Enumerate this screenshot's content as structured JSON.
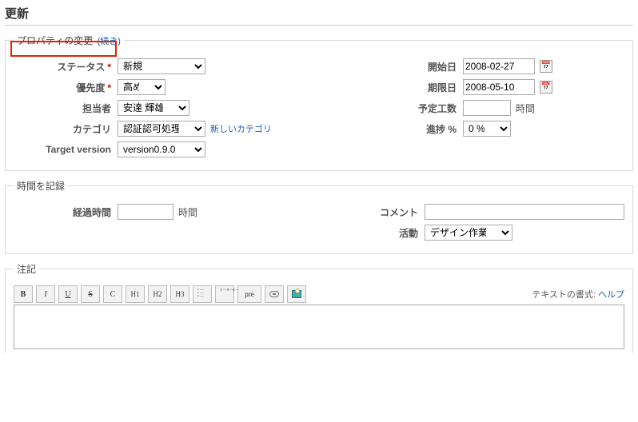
{
  "title": "更新",
  "properties": {
    "legend": "プロパティの変更",
    "more_link": "(続き)",
    "status_label": "ステータス",
    "status_value": "新規",
    "priority_label": "優先度",
    "priority_value": "高め",
    "assignee_label": "担当者",
    "assignee_value": "安達 輝雄",
    "category_label": "カテゴリ",
    "category_value": "認証認可処理",
    "new_category": "新しいカテゴリ",
    "target_version_label": "Target version",
    "target_version_value": "version0.9.0",
    "start_date_label": "開始日",
    "start_date_value": "2008-02-27",
    "due_date_label": "期限日",
    "due_date_value": "2008-05-10",
    "est_hours_label": "予定工数",
    "est_hours_unit": "時間",
    "progress_label": "進捗 %",
    "progress_value": "0 %"
  },
  "time": {
    "legend": "時間を記録",
    "elapsed_label": "経過時間",
    "elapsed_unit": "時間",
    "comment_label": "コメント",
    "activity_label": "活動",
    "activity_value": "デザイン作業"
  },
  "notes": {
    "legend": "注記",
    "format_label": "テキストの書式:",
    "help_link": "ヘルプ"
  },
  "toolbar": {
    "bold": "B",
    "italic": "I",
    "underline": "U",
    "strike": "S",
    "code": "C",
    "h1": "H1",
    "h2": "H2",
    "h3": "H3",
    "pre": "pre"
  }
}
